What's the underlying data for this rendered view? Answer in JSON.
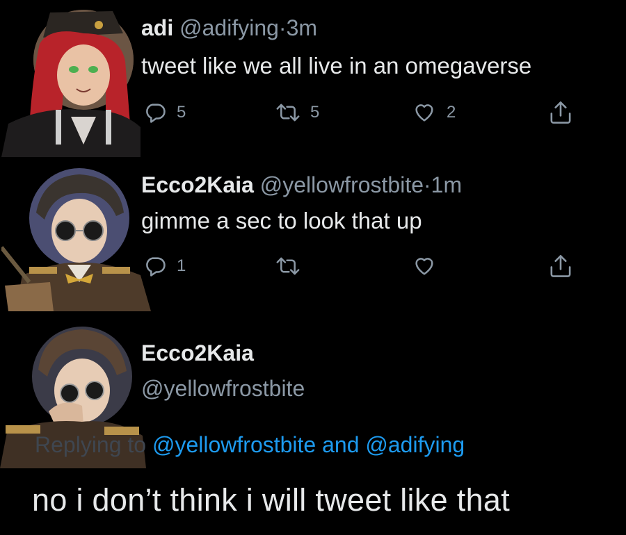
{
  "tweets": [
    {
      "name": "adi",
      "handle": "@adifying",
      "sep": "·",
      "time": "3m",
      "text": "tweet like we all live in an omegaverse",
      "replies": "5",
      "retweets": "5",
      "likes": "2"
    },
    {
      "name": "Ecco2Kaia",
      "handle": "@yellowfrostbite",
      "sep": "·",
      "time": "1m",
      "text": "gimme a sec to look that up",
      "replies": "1",
      "retweets": "",
      "likes": ""
    }
  ],
  "reply": {
    "name": "Ecco2Kaia",
    "handle": "@yellowfrostbite",
    "replying_prefix": "Replying to",
    "replying_user1": "@yellowfrostbite",
    "replying_and": "and",
    "replying_user2": "@adifying",
    "text": "no i don’t think i will tweet like that"
  },
  "icons": {
    "reply": "reply-icon",
    "retweet": "retweet-icon",
    "like": "heart-icon",
    "share": "share-icon"
  },
  "colors": {
    "background": "#000000",
    "text": "#e7e9ea",
    "muted": "#8b98a5",
    "link": "#1d9bf0"
  }
}
